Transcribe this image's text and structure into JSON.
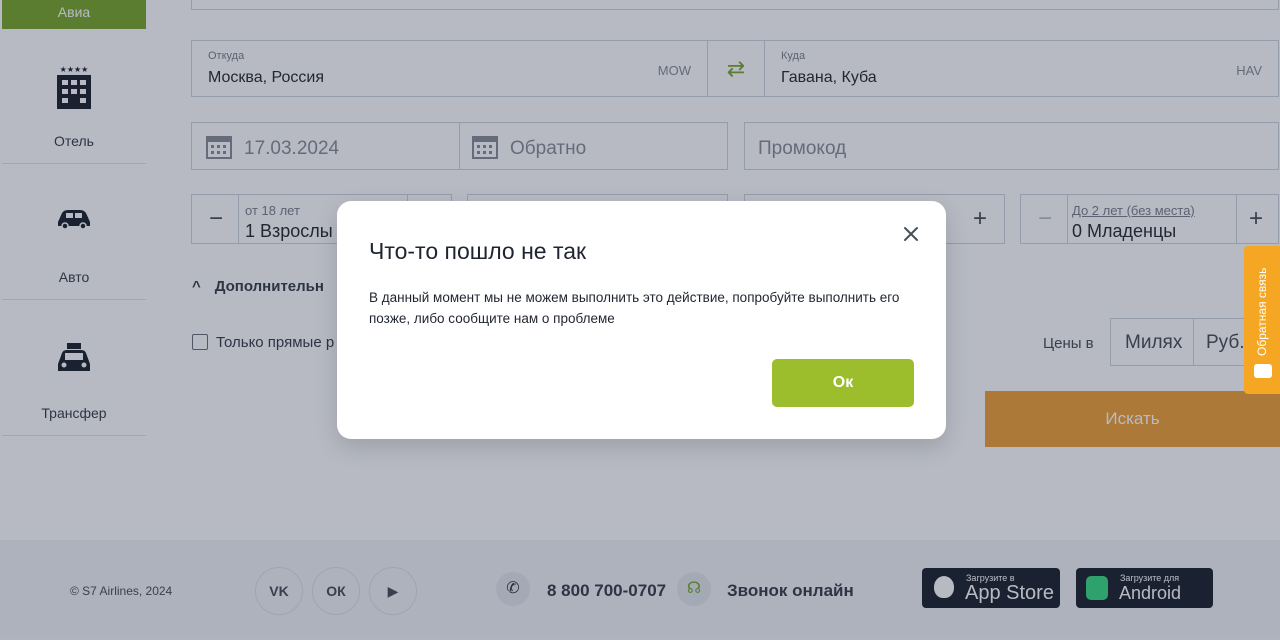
{
  "sidebar": {
    "items": [
      {
        "label": "Авиа"
      },
      {
        "label": "Отель"
      },
      {
        "label": "Авто"
      },
      {
        "label": "Трансфер"
      }
    ]
  },
  "search": {
    "from": {
      "label": "Откуда",
      "value": "Москва, Россия",
      "code": "MOW"
    },
    "to": {
      "label": "Куда",
      "value": "Гавана, Куба",
      "code": "HAV"
    },
    "depart_date": "17.03.2024",
    "return_placeholder": "Обратно",
    "promo_placeholder": "Промокод",
    "adults": {
      "sub": "от 18 лет",
      "value": "1 Взрослы"
    },
    "infants": {
      "sub": "До 2 лет (без места)",
      "value": "0 Младенцы"
    },
    "more_options": "Дополнительн",
    "direct_only": "Только прямые р",
    "prices_label": "Цены в",
    "currency_miles": "Милях",
    "currency_rub": "Руб.",
    "search_button": "Искать"
  },
  "feedback": {
    "label": "Обратная связь"
  },
  "footer": {
    "copyright": "© S7 Airlines, 2024",
    "social": [
      "VK",
      "OK",
      "YouTube"
    ],
    "phone": "8 800 700-0707",
    "call_online": "Звонок онлайн",
    "appstore_top": "Загрузите в",
    "appstore_name": "App Store",
    "android_top": "Загрузите для",
    "android_name": "Android"
  },
  "modal": {
    "title": "Что-то пошло не так",
    "message": "В данный момент мы не можем выполнить это действие, попробуйте выполнить его позже, либо сообщите нам о проблеме",
    "ok_label": "Ок"
  },
  "colors": {
    "brand_green": "#7ba82c",
    "ok_button": "#9cbd2c",
    "search_button": "#f0a23a",
    "feedback_tab": "#f5a623"
  }
}
